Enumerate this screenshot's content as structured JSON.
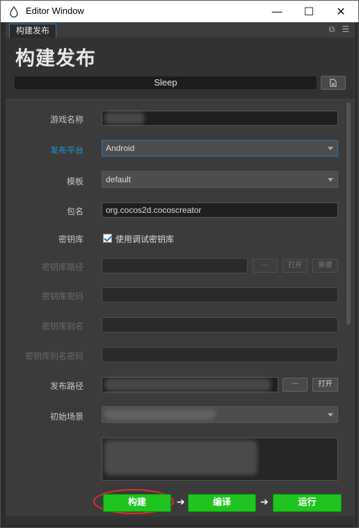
{
  "window": {
    "title": "Editor Window",
    "minimize": "—",
    "maximize": "☐",
    "close": "✕"
  },
  "tab": {
    "label": "构建发布"
  },
  "header": {
    "title": "构建发布",
    "status": "Sleep"
  },
  "form": {
    "game_name": {
      "label": "游戏名称",
      "value": ""
    },
    "platform": {
      "label": "发布平台",
      "value": "Android"
    },
    "template": {
      "label": "模板",
      "value": "default"
    },
    "package": {
      "label": "包名",
      "value": "org.cocos2d.cocoscreator"
    },
    "keystore": {
      "label": "密钥库",
      "checkbox_label": "使用调试密钥库",
      "checked": true
    },
    "keystore_path": {
      "label": "密钥库路径",
      "browse": "···",
      "open": "打开",
      "new": "新建"
    },
    "keystore_password": {
      "label": "密钥库密码"
    },
    "keystore_alias": {
      "label": "密钥库别名"
    },
    "alias_password": {
      "label": "密钥库别名密码"
    },
    "publish_path": {
      "label": "发布路径",
      "browse": "···",
      "open": "打开"
    },
    "initial_scene": {
      "label": "初始场景"
    }
  },
  "actions": {
    "build": "构建",
    "compile": "编译",
    "run": "运行"
  },
  "colors": {
    "accent": "#1b9bd8",
    "action_green": "#1fc41f",
    "highlight_ring": "#e03030"
  }
}
